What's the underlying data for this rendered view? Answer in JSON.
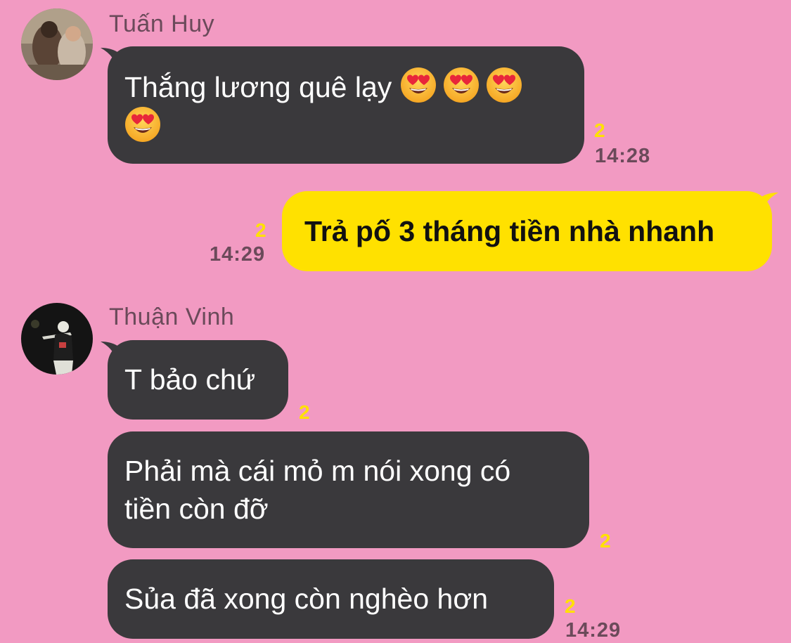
{
  "messages": [
    {
      "sender": "Tuấn Huy",
      "line1": "Thắng lương quê lạy",
      "read_count": "2",
      "time": "14:28"
    },
    {
      "text": "Trả pố 3 tháng tiền nhà nhanh",
      "read_count": "2",
      "time": "14:29"
    },
    {
      "sender": "Thuận Vinh",
      "text": "T bảo chứ",
      "read_count": "2"
    },
    {
      "line1": "Phải mà cái mỏ m nói xong có",
      "line2": "tiền còn đỡ",
      "read_count": "2"
    },
    {
      "text": "Sủa đã xong còn nghèo hơn",
      "read_count": "2",
      "time": "14:29"
    }
  ],
  "icons": {
    "emoji": "heart-eyes-emoji",
    "avatar_1": "user-photo-avatar",
    "avatar_2": "user-photo-avatar"
  },
  "colors": {
    "background": "#F29AC2",
    "incoming_bubble": "#3A393C",
    "outgoing_bubble": "#FFE100",
    "read_count": "#FFE100",
    "meta_text": "#6B4A5A"
  }
}
